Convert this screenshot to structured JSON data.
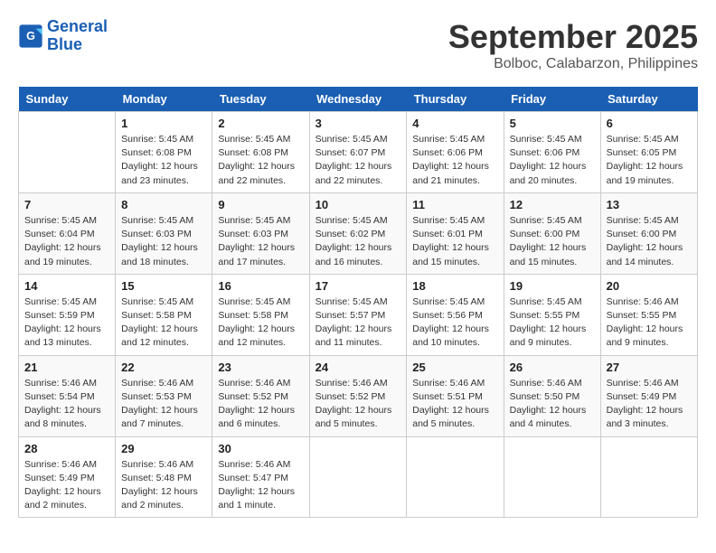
{
  "header": {
    "logo_line1": "General",
    "logo_line2": "Blue",
    "month": "September 2025",
    "location": "Bolboc, Calabarzon, Philippines"
  },
  "weekdays": [
    "Sunday",
    "Monday",
    "Tuesday",
    "Wednesday",
    "Thursday",
    "Friday",
    "Saturday"
  ],
  "weeks": [
    [
      {
        "day": "",
        "info": ""
      },
      {
        "day": "1",
        "info": "Sunrise: 5:45 AM\nSunset: 6:08 PM\nDaylight: 12 hours\nand 23 minutes."
      },
      {
        "day": "2",
        "info": "Sunrise: 5:45 AM\nSunset: 6:08 PM\nDaylight: 12 hours\nand 22 minutes."
      },
      {
        "day": "3",
        "info": "Sunrise: 5:45 AM\nSunset: 6:07 PM\nDaylight: 12 hours\nand 22 minutes."
      },
      {
        "day": "4",
        "info": "Sunrise: 5:45 AM\nSunset: 6:06 PM\nDaylight: 12 hours\nand 21 minutes."
      },
      {
        "day": "5",
        "info": "Sunrise: 5:45 AM\nSunset: 6:06 PM\nDaylight: 12 hours\nand 20 minutes."
      },
      {
        "day": "6",
        "info": "Sunrise: 5:45 AM\nSunset: 6:05 PM\nDaylight: 12 hours\nand 19 minutes."
      }
    ],
    [
      {
        "day": "7",
        "info": "Sunrise: 5:45 AM\nSunset: 6:04 PM\nDaylight: 12 hours\nand 19 minutes."
      },
      {
        "day": "8",
        "info": "Sunrise: 5:45 AM\nSunset: 6:03 PM\nDaylight: 12 hours\nand 18 minutes."
      },
      {
        "day": "9",
        "info": "Sunrise: 5:45 AM\nSunset: 6:03 PM\nDaylight: 12 hours\nand 17 minutes."
      },
      {
        "day": "10",
        "info": "Sunrise: 5:45 AM\nSunset: 6:02 PM\nDaylight: 12 hours\nand 16 minutes."
      },
      {
        "day": "11",
        "info": "Sunrise: 5:45 AM\nSunset: 6:01 PM\nDaylight: 12 hours\nand 15 minutes."
      },
      {
        "day": "12",
        "info": "Sunrise: 5:45 AM\nSunset: 6:00 PM\nDaylight: 12 hours\nand 15 minutes."
      },
      {
        "day": "13",
        "info": "Sunrise: 5:45 AM\nSunset: 6:00 PM\nDaylight: 12 hours\nand 14 minutes."
      }
    ],
    [
      {
        "day": "14",
        "info": "Sunrise: 5:45 AM\nSunset: 5:59 PM\nDaylight: 12 hours\nand 13 minutes."
      },
      {
        "day": "15",
        "info": "Sunrise: 5:45 AM\nSunset: 5:58 PM\nDaylight: 12 hours\nand 12 minutes."
      },
      {
        "day": "16",
        "info": "Sunrise: 5:45 AM\nSunset: 5:58 PM\nDaylight: 12 hours\nand 12 minutes."
      },
      {
        "day": "17",
        "info": "Sunrise: 5:45 AM\nSunset: 5:57 PM\nDaylight: 12 hours\nand 11 minutes."
      },
      {
        "day": "18",
        "info": "Sunrise: 5:45 AM\nSunset: 5:56 PM\nDaylight: 12 hours\nand 10 minutes."
      },
      {
        "day": "19",
        "info": "Sunrise: 5:45 AM\nSunset: 5:55 PM\nDaylight: 12 hours\nand 9 minutes."
      },
      {
        "day": "20",
        "info": "Sunrise: 5:46 AM\nSunset: 5:55 PM\nDaylight: 12 hours\nand 9 minutes."
      }
    ],
    [
      {
        "day": "21",
        "info": "Sunrise: 5:46 AM\nSunset: 5:54 PM\nDaylight: 12 hours\nand 8 minutes."
      },
      {
        "day": "22",
        "info": "Sunrise: 5:46 AM\nSunset: 5:53 PM\nDaylight: 12 hours\nand 7 minutes."
      },
      {
        "day": "23",
        "info": "Sunrise: 5:46 AM\nSunset: 5:52 PM\nDaylight: 12 hours\nand 6 minutes."
      },
      {
        "day": "24",
        "info": "Sunrise: 5:46 AM\nSunset: 5:52 PM\nDaylight: 12 hours\nand 5 minutes."
      },
      {
        "day": "25",
        "info": "Sunrise: 5:46 AM\nSunset: 5:51 PM\nDaylight: 12 hours\nand 5 minutes."
      },
      {
        "day": "26",
        "info": "Sunrise: 5:46 AM\nSunset: 5:50 PM\nDaylight: 12 hours\nand 4 minutes."
      },
      {
        "day": "27",
        "info": "Sunrise: 5:46 AM\nSunset: 5:49 PM\nDaylight: 12 hours\nand 3 minutes."
      }
    ],
    [
      {
        "day": "28",
        "info": "Sunrise: 5:46 AM\nSunset: 5:49 PM\nDaylight: 12 hours\nand 2 minutes."
      },
      {
        "day": "29",
        "info": "Sunrise: 5:46 AM\nSunset: 5:48 PM\nDaylight: 12 hours\nand 2 minutes."
      },
      {
        "day": "30",
        "info": "Sunrise: 5:46 AM\nSunset: 5:47 PM\nDaylight: 12 hours\nand 1 minute."
      },
      {
        "day": "",
        "info": ""
      },
      {
        "day": "",
        "info": ""
      },
      {
        "day": "",
        "info": ""
      },
      {
        "day": "",
        "info": ""
      }
    ]
  ]
}
